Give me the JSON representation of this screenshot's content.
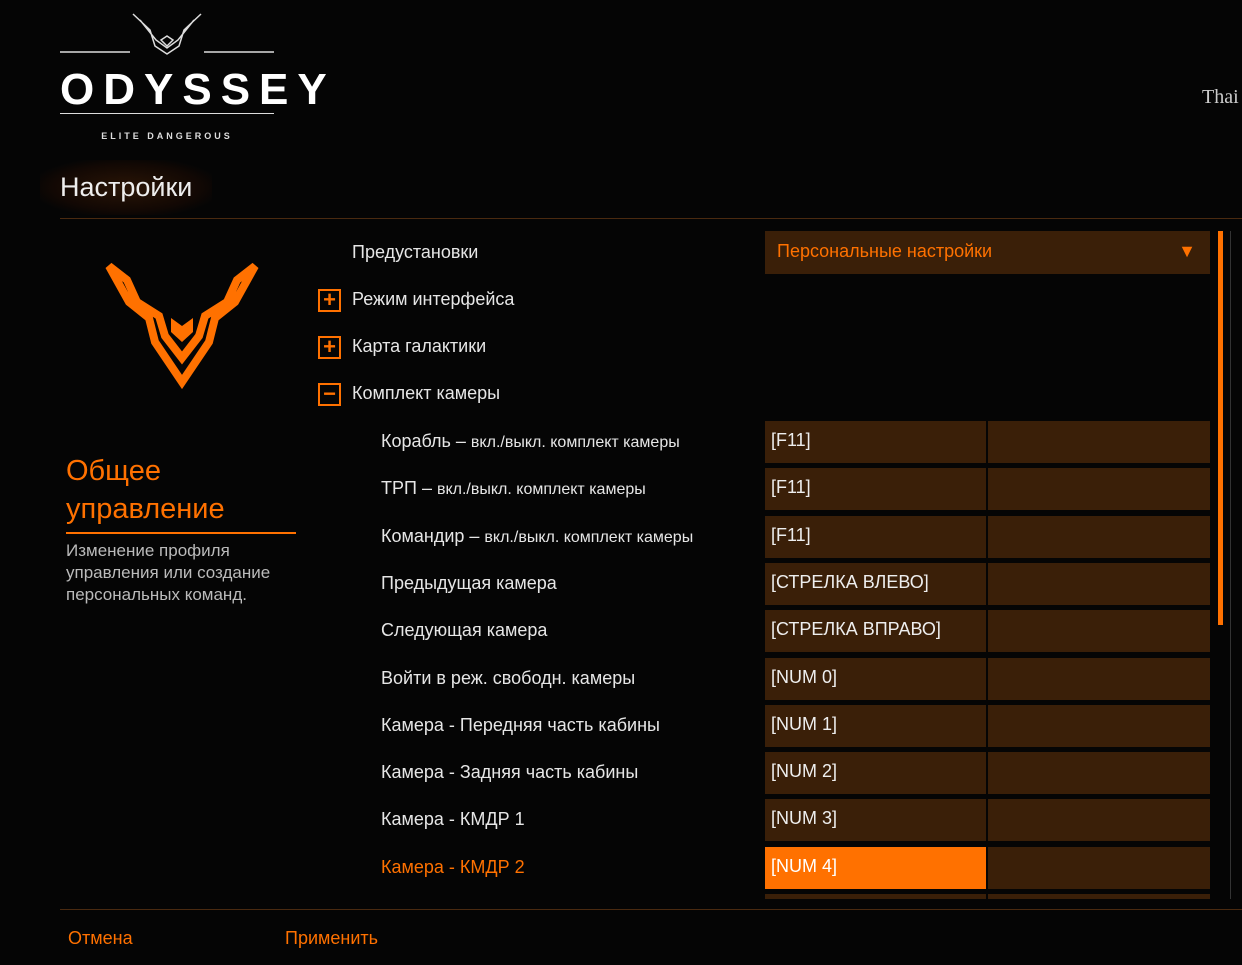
{
  "logo": {
    "word": "ODYSSEY",
    "sub": "ELITE DANGEROUS"
  },
  "user": "Thai",
  "title": "Настройки",
  "category": {
    "title": "Общее управление",
    "description": "Изменение профиля управления или создание персональных команд."
  },
  "presets": {
    "label": "Предустановки",
    "value": "Персональные настройки"
  },
  "groups": [
    {
      "label": "Режим интерфейса",
      "state": "+"
    },
    {
      "label": "Карта галактики",
      "state": "+"
    },
    {
      "label": "Комплект камеры",
      "state": "−"
    }
  ],
  "rows": [
    {
      "label": "Корабль – ",
      "small": "вкл./выкл. комплект камеры",
      "key": "[F11]"
    },
    {
      "label": "ТРП – ",
      "small": "вкл./выкл. комплект камеры",
      "key": "[F11]"
    },
    {
      "label": "Командир – ",
      "small": "вкл./выкл. комплект камеры",
      "key": "[F11]"
    },
    {
      "label": "Предыдущая камера",
      "small": "",
      "key": "[СТРЕЛКА ВЛЕВО]"
    },
    {
      "label": "Следующая камера",
      "small": "",
      "key": "[СТРЕЛКА ВПРАВО]"
    },
    {
      "label": "Войти в реж. свободн. камеры",
      "small": "",
      "key": "[NUM 0]"
    },
    {
      "label": "Камера - Передняя часть кабины",
      "small": "",
      "key": "[NUM 1]"
    },
    {
      "label": "Камера - Задняя часть кабины",
      "small": "",
      "key": "[NUM 2]"
    },
    {
      "label": "Камера - КМДР 1",
      "small": "",
      "key": "[NUM 3]"
    },
    {
      "label": "Камера - КМДР 2",
      "small": "",
      "key": "[NUM 4]"
    }
  ],
  "footer": {
    "cancel": "Отмена",
    "apply": "Применить"
  },
  "colors": {
    "accent": "#ff7100",
    "panel": "#3a1f08"
  }
}
